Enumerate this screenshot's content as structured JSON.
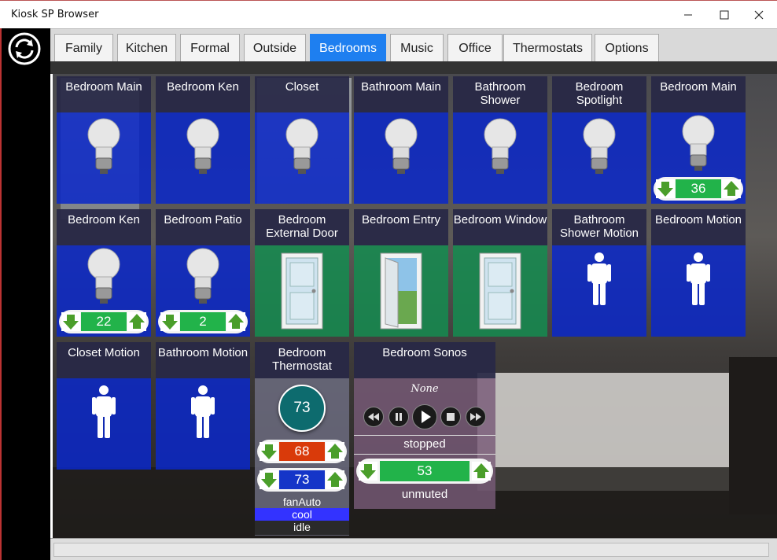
{
  "window": {
    "title": "Kiosk SP Browser"
  },
  "tabs": [
    {
      "label": "Family",
      "active": false
    },
    {
      "label": "Kitchen",
      "active": false
    },
    {
      "label": "Formal",
      "active": false
    },
    {
      "label": "Outside",
      "active": false
    },
    {
      "label": "Bedrooms",
      "active": true
    },
    {
      "label": "Music",
      "active": false
    },
    {
      "label": "Office",
      "active": false
    },
    {
      "label": "Thermostats",
      "active": false
    },
    {
      "label": "Options",
      "active": false
    }
  ],
  "tiles": {
    "bedroom_main_1": {
      "title": "Bedroom Main",
      "icon": "lightbulb-icon"
    },
    "bedroom_ken_1": {
      "title": "Bedroom Ken",
      "icon": "lightbulb-icon"
    },
    "closet": {
      "title": "Closet",
      "icon": "lightbulb-icon"
    },
    "bathroom_main": {
      "title": "Bathroom Main",
      "icon": "lightbulb-icon"
    },
    "bathroom_shower": {
      "title": "Bathroom Shower",
      "icon": "lightbulb-icon"
    },
    "bedroom_spotlight": {
      "title": "Bedroom Spotlight",
      "icon": "lightbulb-icon"
    },
    "bedroom_main_2": {
      "title": "Bedroom Main",
      "icon": "lightbulb-icon",
      "level": "36"
    },
    "bedroom_ken_2": {
      "title": "Bedroom Ken",
      "icon": "lightbulb-icon",
      "level": "22"
    },
    "bedroom_patio": {
      "title": "Bedroom Patio",
      "icon": "lightbulb-icon",
      "level": "2"
    },
    "bedroom_external_door": {
      "title": "Bedroom External Door",
      "icon": "door-closed-icon"
    },
    "bedroom_entry": {
      "title": "Bedroom Entry",
      "icon": "door-open-icon"
    },
    "bedroom_window": {
      "title": "Bedroom Window",
      "icon": "door-closed-icon"
    },
    "bathroom_shower_motion": {
      "title": "Bathroom Shower Motion",
      "icon": "person-icon"
    },
    "bedroom_motion": {
      "title": "Bedroom Motion",
      "icon": "person-icon"
    },
    "closet_motion": {
      "title": "Closet Motion",
      "icon": "person-icon"
    },
    "bathroom_motion": {
      "title": "Bathroom Motion",
      "icon": "person-icon"
    }
  },
  "thermostat": {
    "title": "Bedroom Thermostat",
    "current_temp": "73",
    "heat_setpoint": "68",
    "cool_setpoint": "73",
    "fan_mode": "fanAuto",
    "mode": "cool",
    "state": "idle"
  },
  "sonos": {
    "title": "Bedroom Sonos",
    "track": "None",
    "status": "stopped",
    "volume": "53",
    "mute_status": "unmuted"
  },
  "colors": {
    "tab_active": "#1e7ff0",
    "tile_blue": "#0a28c8",
    "tile_green": "#148c50",
    "level_green": "#22b34a",
    "heat_orange": "#d93a0a",
    "cool_blue": "#1535c8",
    "mode_blue": "#3333ff"
  }
}
